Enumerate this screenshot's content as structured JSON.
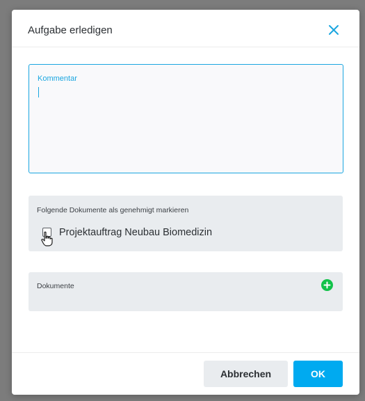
{
  "dialog": {
    "title": "Aufgabe erledigen",
    "close_icon": "close-icon"
  },
  "comment": {
    "label": "Kommentar",
    "value": ""
  },
  "approval": {
    "label": "Folgende Dokumente als genehmigt markieren",
    "items": [
      {
        "name": "Projektauftrag Neubau Biomedizin",
        "checked": false
      }
    ]
  },
  "documents": {
    "label": "Dokumente",
    "add_icon": "plus-circle-icon"
  },
  "footer": {
    "cancel_label": "Abbrechen",
    "ok_label": "OK"
  },
  "colors": {
    "accent": "#00aaf0",
    "focus_border": "#1aa6e0",
    "add_green": "#12c24a",
    "panel_bg": "#e9ecef",
    "overlay": "#7c7c7c"
  }
}
